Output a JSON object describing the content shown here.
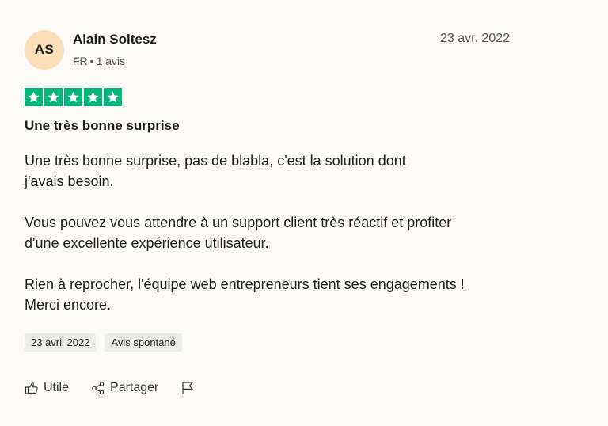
{
  "reviewer": {
    "initials": "AS",
    "name": "Alain Soltesz",
    "country": "FR",
    "separator": "•",
    "review_count": "1 avis"
  },
  "review": {
    "date": "23 avr. 2022",
    "rating": 5,
    "title": "Une très bonne surprise",
    "paragraphs": [
      "Une très bonne surprise, pas de blabla, c'est la solution dont\nj'avais besoin.",
      "Vous pouvez vous attendre à un support client très réactif et profiter\nd'une excellente expérience utilisateur.",
      "Rien à reprocher, l'équipe web entrepreneurs tient ses engagements !\nMerci encore."
    ],
    "tags": [
      "23 avril 2022",
      "Avis spontané"
    ]
  },
  "actions": {
    "useful_label": "Utile",
    "share_label": "Partager",
    "useful_icon": "thumbs-up-icon",
    "share_icon": "share-icon",
    "flag_icon": "flag-icon"
  },
  "colors": {
    "star_green": "#00b67a",
    "avatar_bg": "#fadfb9",
    "tag_bg": "#ececea"
  }
}
